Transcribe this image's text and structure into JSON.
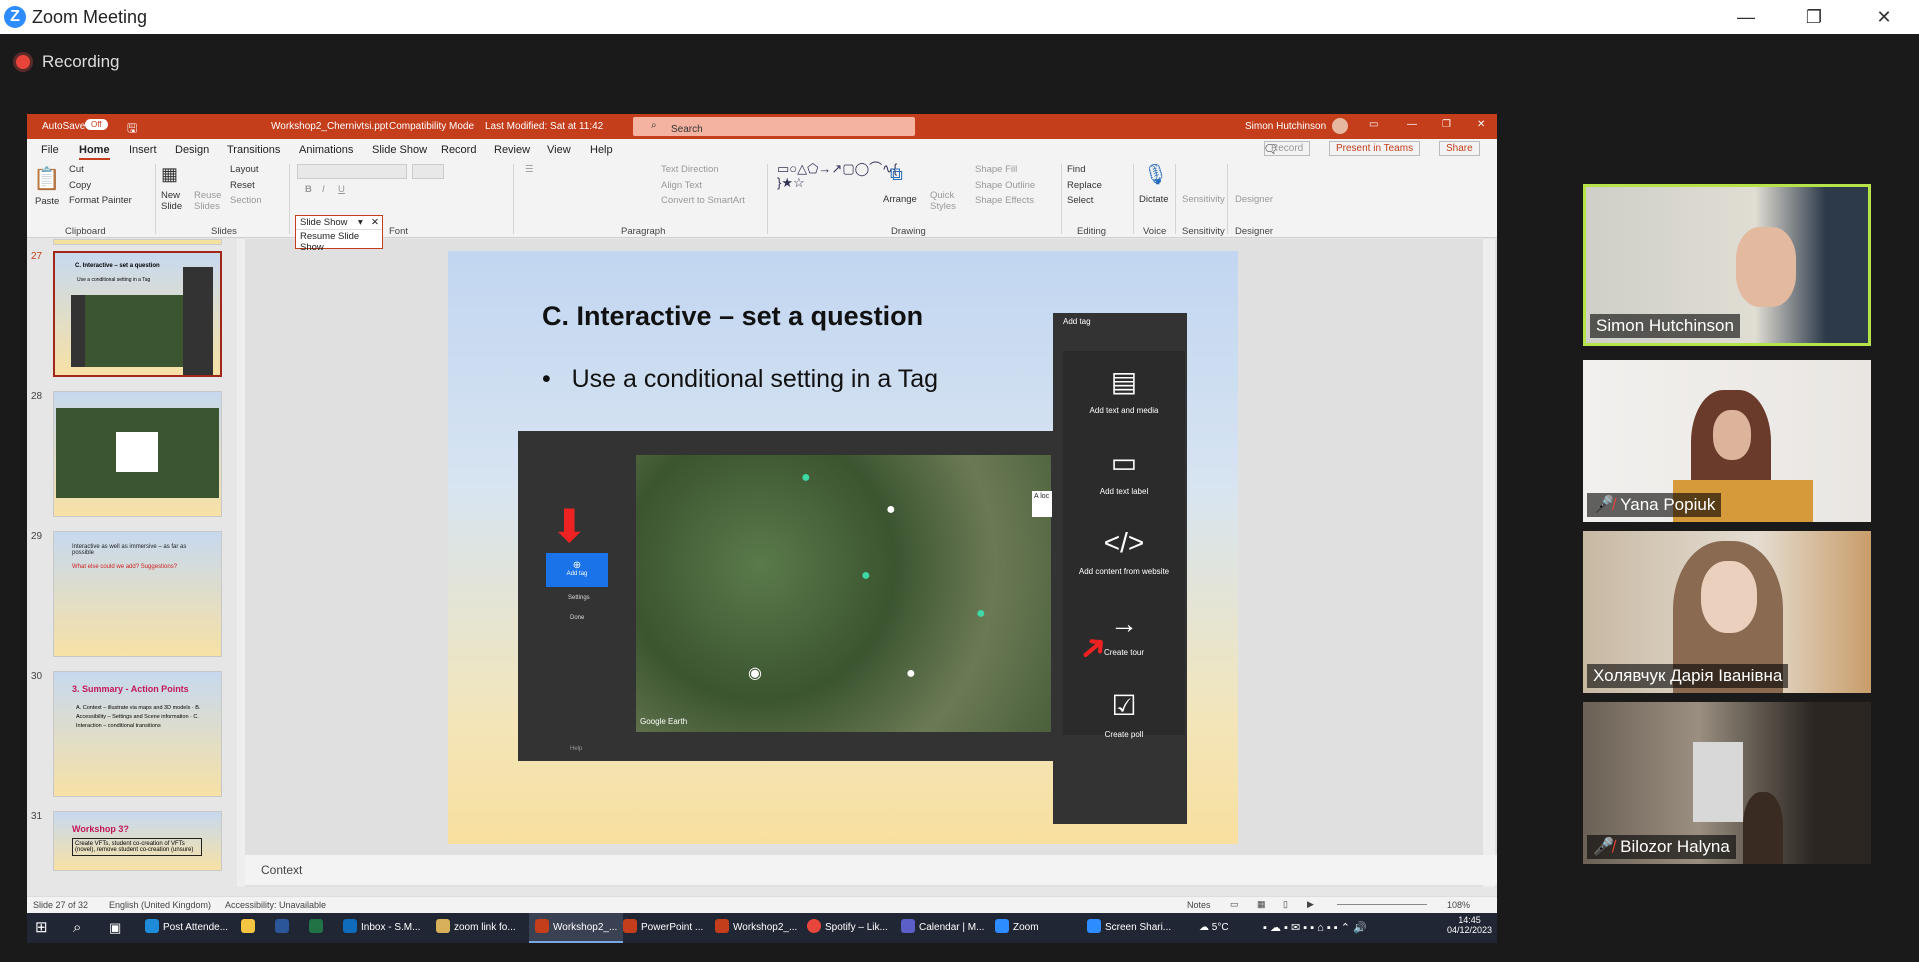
{
  "window": {
    "title": "Zoom Meeting",
    "minimize": "—",
    "restore": "❐",
    "close": "✕"
  },
  "recording": {
    "label": "Recording"
  },
  "ppt": {
    "autosave": "AutoSave",
    "autosave_state": "Off",
    "filename": "Workshop2_Chernivtsi.ppt",
    "mode": "Compatibility Mode",
    "modified": "Last Modified: Sat at 11:42",
    "search_placeholder": "Search",
    "user": "Simon Hutchinson",
    "menu": [
      "File",
      "Home",
      "Insert",
      "Design",
      "Transitions",
      "Animations",
      "Slide Show",
      "Record",
      "Review",
      "View",
      "Help"
    ],
    "active_tab": "Home",
    "record_btn": "Record",
    "present_btn": "Present in Teams",
    "share_btn": "Share",
    "ribbon": {
      "paste": "Paste",
      "cut": "Cut",
      "copy": "Copy",
      "format_painter": "Format Painter",
      "new_slide": "New Slide",
      "reuse_slides": "Reuse Slides",
      "layout": "Layout",
      "reset": "Reset",
      "section": "Section",
      "text_direction": "Text Direction",
      "align_text": "Align Text",
      "convert_smartart": "Convert to SmartArt",
      "arrange": "Arrange",
      "quick_styles": "Quick Styles",
      "shape_fill": "Shape Fill",
      "shape_outline": "Shape Outline",
      "shape_effects": "Shape Effects",
      "find": "Find",
      "replace": "Replace",
      "select": "Select",
      "dictate": "Dictate",
      "sensitivity": "Sensitivity",
      "designer": "Designer",
      "groups": [
        "Clipboard",
        "Slides",
        "Font",
        "Paragraph",
        "Drawing",
        "Editing",
        "Voice",
        "Sensitivity",
        "Designer"
      ]
    },
    "slideshow_menu": {
      "title": "Slide Show",
      "item": "Resume Slide Show"
    },
    "thumbnails": [
      {
        "num": "27",
        "title": "C. Interactive – set a question",
        "body": "Use a conditional setting in a Tag"
      },
      {
        "num": "28",
        "title": "",
        "body": ""
      },
      {
        "num": "29",
        "title": "Interactive as well as immersive – as far as possible",
        "body": "What else could we add? Suggestions?"
      },
      {
        "num": "30",
        "title": "3. Summary - Action Points",
        "body": "A. Context – illustrate via maps and 3D models · B. Accessibility – Settings and Scene information · C. Interaction – conditional transitions"
      },
      {
        "num": "31",
        "title": "Workshop 3?",
        "body": "Create VFTs, student co-creation of VFTs (novel), remove student co-creation (unsure)"
      }
    ],
    "slide": {
      "title": "C. Interactive – set a question",
      "bullet": "Use a conditional setting in a Tag",
      "screenshot": {
        "add_tag_btn": "Add tag",
        "settings": "Settings",
        "done": "Done",
        "help": "Help",
        "google_earth": "Google Earth",
        "panel_title": "Add tag",
        "panel_items": [
          "Add text and media",
          "Add text label",
          "Add content from website",
          "Create tour",
          "Create poll"
        ],
        "callout": "A loc"
      }
    },
    "notes_placeholder": "Context",
    "status": {
      "slide": "Slide 27 of 32",
      "language": "English (United Kingdom)",
      "accessibility": "Accessibility: Unavailable",
      "notes": "Notes",
      "zoom": "108%"
    },
    "taskbar": {
      "items": [
        "Post Attende...",
        "Inbox - S.M...",
        "zoom link fo...",
        "Workshop2_...",
        "PowerPoint ...",
        "Workshop2_...",
        "Spotify – Lik...",
        "Calendar | M...",
        "Zoom",
        "Screen Shari..."
      ],
      "weather": "5°C",
      "time": "14:45",
      "date": "04/12/2023"
    }
  },
  "participants": [
    {
      "name": "Simon Hutchinson",
      "muted": false,
      "active": true
    },
    {
      "name": "Yana Popiuk",
      "muted": true,
      "active": false
    },
    {
      "name": "Холявчук Дарія Іванівна",
      "muted": false,
      "active": false
    },
    {
      "name": "Bilozor Halyna",
      "muted": true,
      "active": false
    }
  ]
}
